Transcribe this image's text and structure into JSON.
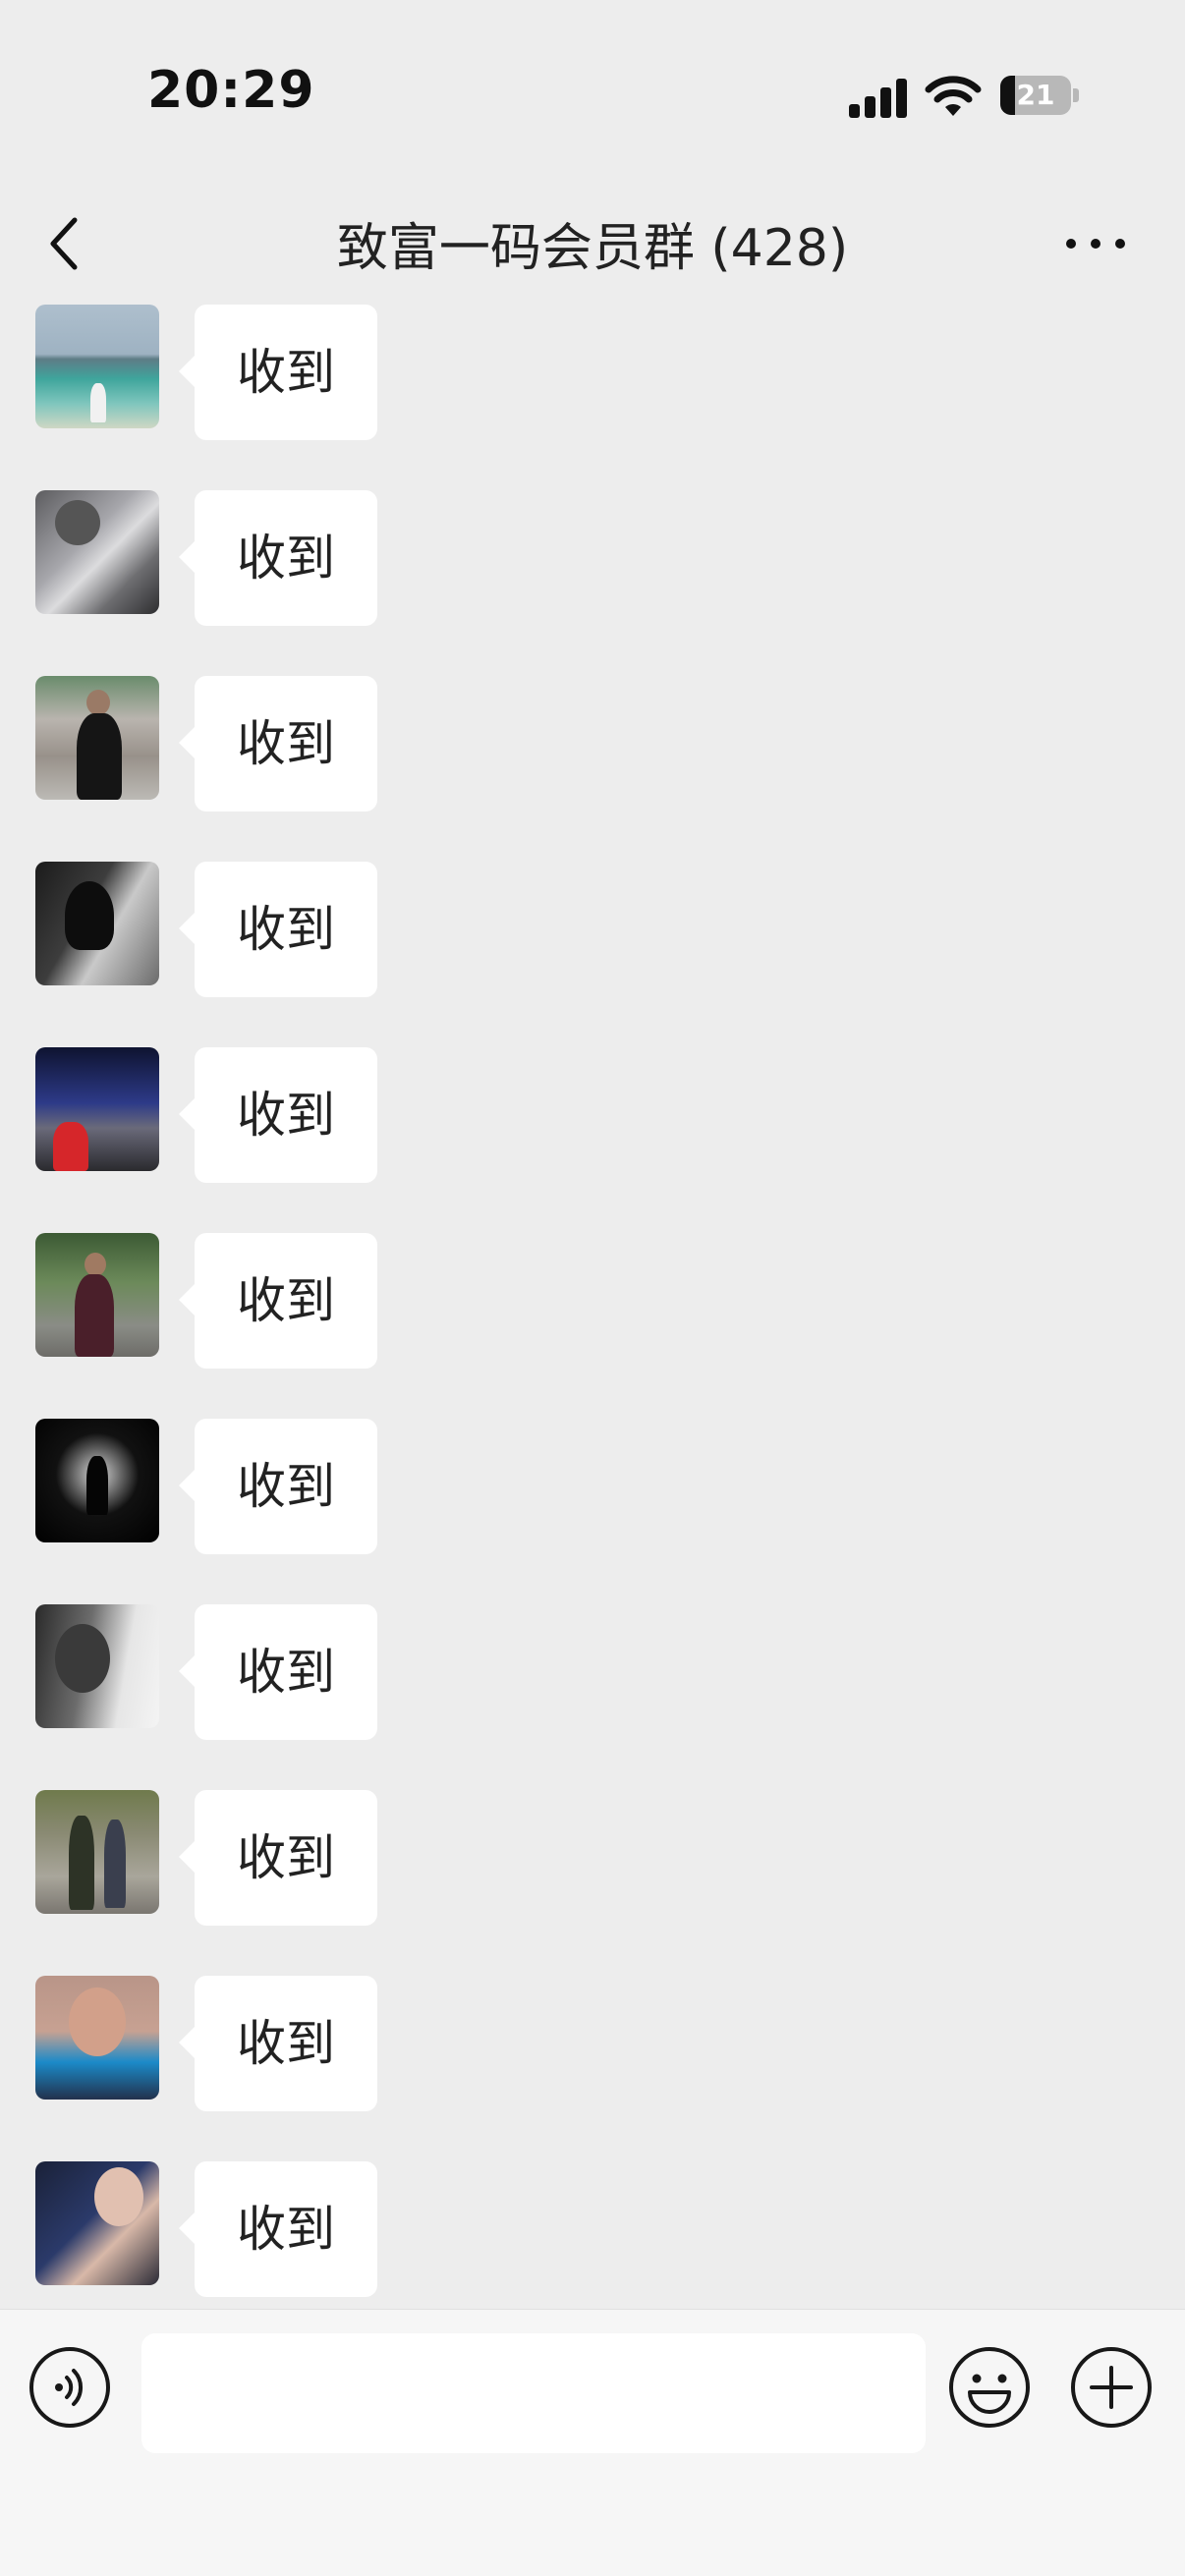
{
  "status_bar": {
    "time": "20:29",
    "battery_level": "21"
  },
  "nav": {
    "title": "致富一码会员群 (428)",
    "back_icon": "chevron-left-icon",
    "more_icon": "more-dots-icon"
  },
  "messages": [
    {
      "text": "收到",
      "avatar": "avatar-beach"
    },
    {
      "text": "收到",
      "avatar": "avatar-husky"
    },
    {
      "text": "收到",
      "avatar": "avatar-man-street"
    },
    {
      "text": "收到",
      "avatar": "avatar-woman-bw"
    },
    {
      "text": "收到",
      "avatar": "avatar-concert"
    },
    {
      "text": "收到",
      "avatar": "avatar-man-garden"
    },
    {
      "text": "收到",
      "avatar": "avatar-gunbarrel"
    },
    {
      "text": "收到",
      "avatar": "avatar-man-bw"
    },
    {
      "text": "收到",
      "avatar": "avatar-group-car"
    },
    {
      "text": "收到",
      "avatar": "avatar-man-blue-jacket"
    },
    {
      "text": "收到",
      "avatar": "avatar-woman-car"
    }
  ],
  "input_bar": {
    "input_value": "",
    "voice_icon": "voice-icon",
    "emoji_icon": "emoji-icon",
    "plus_icon": "plus-circle-icon"
  },
  "colors": {
    "background": "#ededed",
    "bubble": "#ffffff",
    "input_bar": "#f6f6f6",
    "text": "#222222"
  }
}
